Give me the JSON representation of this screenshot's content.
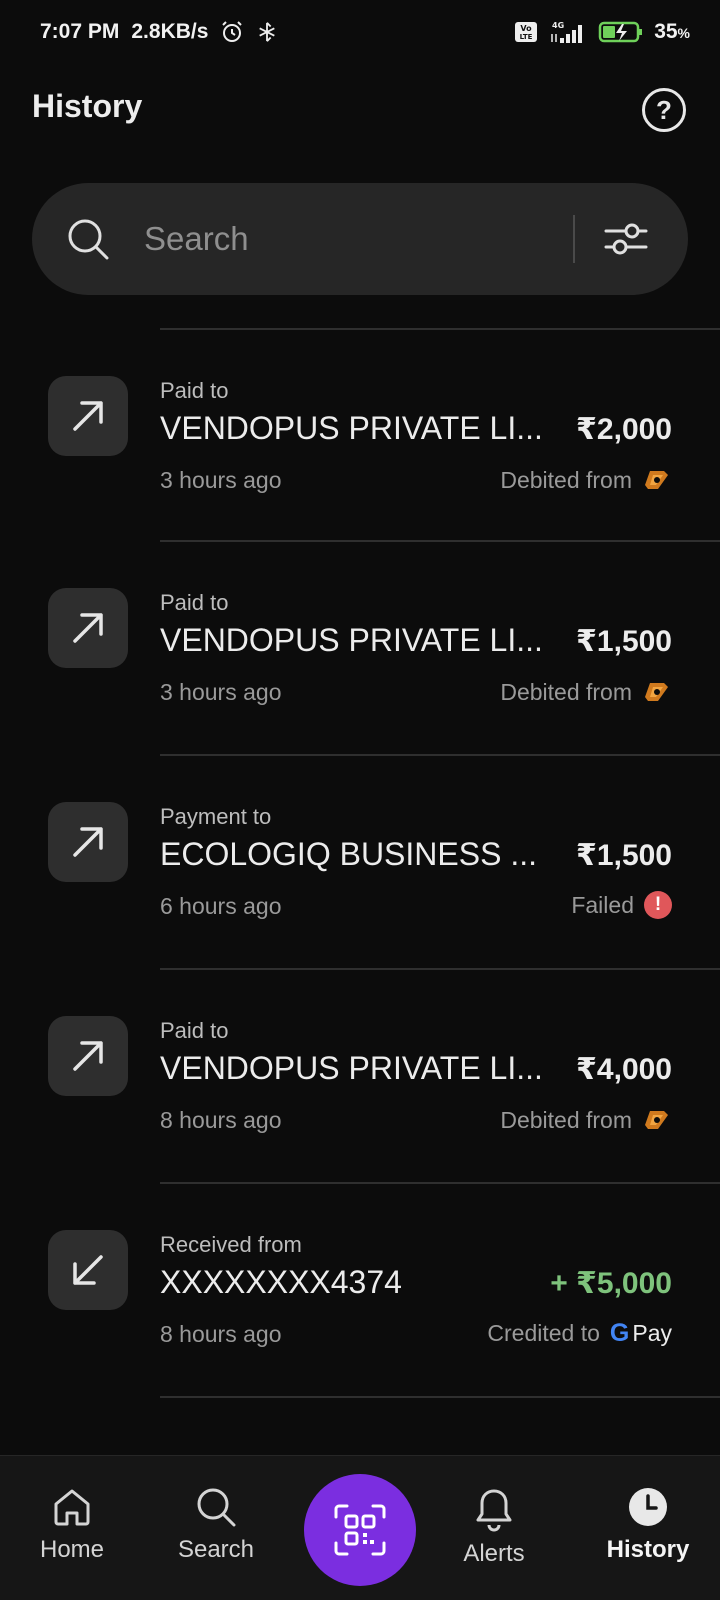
{
  "status_bar": {
    "time": "7:07 PM",
    "speed": "2.8KB/s",
    "battery_pct": "35",
    "battery_unit": "%",
    "icons": [
      "alarm-icon",
      "bluetooth-icon",
      "volte-icon",
      "signal-4g-icon",
      "battery-charging-icon"
    ]
  },
  "header": {
    "title": "History",
    "help_icon": "help-circle-icon"
  },
  "search": {
    "placeholder": "Search",
    "value": "",
    "filter_icon": "filter-sliders-icon"
  },
  "transactions": [
    {
      "direction": "out",
      "type": "Paid to",
      "name": "VENDOPUS PRIVATE LI...",
      "amount": "₹2,000",
      "time": "3 hours ago",
      "status_text": "Debited from",
      "status_icon": "bank-logo-icon"
    },
    {
      "direction": "out",
      "type": "Paid to",
      "name": "VENDOPUS PRIVATE LI...",
      "amount": "₹1,500",
      "time": "3 hours ago",
      "status_text": "Debited from",
      "status_icon": "bank-logo-icon"
    },
    {
      "direction": "out",
      "type": "Payment to",
      "name": "ECOLOGIQ BUSINESS ...",
      "amount": "₹1,500",
      "time": "6 hours ago",
      "status_text": "Failed",
      "status_icon": "failed-alert-icon"
    },
    {
      "direction": "out",
      "type": "Paid to",
      "name": "VENDOPUS PRIVATE LI...",
      "amount": "₹4,000",
      "time": "8 hours ago",
      "status_text": "Debited from",
      "status_icon": "bank-logo-icon"
    },
    {
      "direction": "in",
      "type": "Received from",
      "name": "XXXXXXXX4374",
      "amount": "+ ₹5,000",
      "time": "8 hours ago",
      "status_text": "Credited to",
      "status_icon": "gpay-logo-icon",
      "gpay_g": "G",
      "gpay_text": "Pay"
    }
  ],
  "bottom_nav": {
    "items": [
      {
        "label": "Home",
        "icon": "home-icon"
      },
      {
        "label": "Search",
        "icon": "search-icon"
      },
      {
        "label": "",
        "icon": "qr-scan-icon"
      },
      {
        "label": "Alerts",
        "icon": "bell-icon"
      },
      {
        "label": "History",
        "icon": "clock-icon",
        "active": true
      }
    ]
  },
  "colors": {
    "background": "#0c0c0c",
    "accent_purple": "#7b2ee0",
    "credit_green": "#7ec37c",
    "failed_red": "#e0575a"
  }
}
